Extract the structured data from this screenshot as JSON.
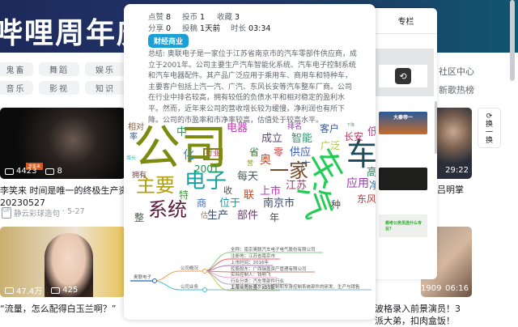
{
  "banner": {
    "title": "哔哩周年庆"
  },
  "categories": [
    [
      "鬼畜",
      "舞蹈",
      "娱乐"
    ],
    [
      "音乐",
      "影视",
      "知识"
    ]
  ],
  "right_links": [
    "社区中心",
    "新歌热榜"
  ],
  "videos": [
    {
      "views": "4423",
      "danmaku": "8",
      "title_lines": [
        "李笑来 时间是唯一的终极生产资",
        "20230527"
      ],
      "author": "静云彩球造句",
      "date": "5-27",
      "overlay_tag": "李笑来"
    },
    {
      "views": "47.4万",
      "danmaku": "425",
      "title_lines": [
        "“流量，怎么配得白玉兰啊？”"
      ]
    },
    {
      "duration": "29:22",
      "title_partial": "吕明掌"
    },
    {
      "danmaku": "1909",
      "duration": "06:16",
      "title_lines": [
        "波格录入前景演员！3",
        "派大弟，扣肉盒饭！"
      ]
    }
  ],
  "refresh_button": {
    "label_lines": [
      "换",
      "一",
      "换"
    ]
  },
  "popup": {
    "stats": [
      [
        "点赞",
        "8"
      ],
      [
        "投币",
        "1"
      ],
      [
        "收藏",
        "3"
      ],
      [
        "分享",
        "0"
      ],
      [
        "投稿",
        "1天前"
      ],
      [
        "时长",
        "03:34"
      ]
    ],
    "tag": "财经商业",
    "summary": "总结: 奥联电子是一家位于江苏省南京市的汽车零部件供应商，成立于2001年。公司主要生产汽车智能化系统、汽车电子控制系统和汽车电器配件。其产品广泛应用于乘用车、商用车和特种车，主要客户包括上汽一汽、广汽、东风长安等汽车整车厂商。公司在行业中排名较高，拥有较低的负债水平和相对稳定的盈利水平。然而，近年来公司的营收增长较为缓慢，净利润也有所下降。公司的市盈率和市净率较高，估值处于较高水平。",
    "wordcloud": [
      "公司",
      "车",
      "汽",
      "车",
      "电子",
      "主要",
      "系统",
      "一家",
      "2001",
      "行业",
      "相对",
      "率",
      "中",
      "化",
      "电器",
      "成立",
      "智能",
      "排名",
      "客户",
      "长安",
      "低",
      "省",
      "奥",
      "零",
      "供应",
      "广泛",
      "广",
      "每天",
      "上市",
      "江苏",
      "应用",
      "高",
      "东风",
      "南京市",
      "位于",
      "生产",
      "部件",
      "商",
      "特",
      "联",
      "收",
      "种",
      "年",
      "整",
      "估",
      "拥有",
      "增长",
      "下降",
      "营",
      "净"
    ],
    "mindmap": {
      "root": "奥联电子",
      "branches": [
        {
          "label": "公司概况",
          "leaves": [
            "全称：南京奥联汽车电子电气股份有限公司",
            "注册地：江苏省南京市",
            "上市时间：2016年",
            "控股股东：广西瑞盈资产管理有限公司",
            "实际控制人：钱明飞",
            "行业分类：汽车零部件行业",
            "上市公司数量：221家"
          ]
        },
        {
          "label": "公司业务",
          "leaves": [
            "主营业务：汽车动力控制和车身控制系统部件的研发、生产与销售"
          ]
        }
      ]
    }
  },
  "side_panel": {
    "header": "专栏",
    "thumb_texts": [
      "大秦帝一",
      "想考公务员选什么专业？"
    ]
  }
}
